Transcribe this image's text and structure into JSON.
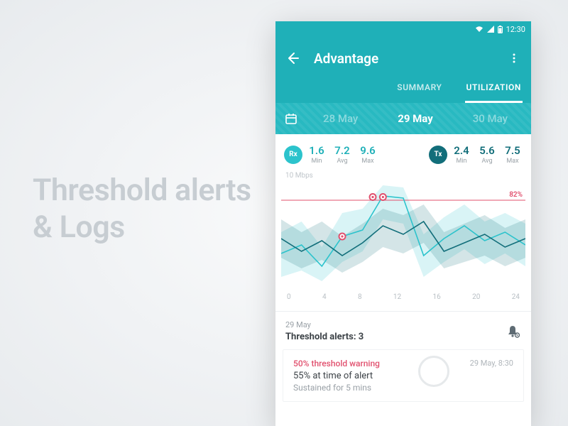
{
  "background_title_line1": "Threshold alerts",
  "background_title_line2": "& Logs",
  "statusbar": {
    "time": "12:30"
  },
  "appbar": {
    "title": "Advantage"
  },
  "tabs": {
    "summary": "SUMMARY",
    "utilization": "UTILIZATION",
    "active": "utilization"
  },
  "dates": {
    "d0": "28 May",
    "d1": "29 May",
    "d2": "30 May",
    "active": "d1"
  },
  "metrics": {
    "rx": {
      "badge": "Rx",
      "min": "1.6",
      "avg": "7.2",
      "max": "9.6"
    },
    "tx": {
      "badge": "Tx",
      "min": "2.4",
      "avg": "5.6",
      "max": "7.5"
    },
    "labels": {
      "min": "Min",
      "avg": "Avg",
      "max": "Max"
    }
  },
  "chart_data": {
    "type": "line",
    "ylabel": "10 Mbps",
    "ylim": [
      0,
      10
    ],
    "threshold_pct": "82%",
    "threshold_value": 8.2,
    "x": [
      0,
      2,
      4,
      6,
      8,
      10,
      12,
      14,
      16,
      18,
      20,
      22,
      24
    ],
    "x_ticks": [
      "0",
      "4",
      "8",
      "12",
      "16",
      "20",
      "24"
    ],
    "series": [
      {
        "name": "Rx",
        "color": "#2cc3cc",
        "values": [
          3.2,
          4.0,
          2.0,
          4.8,
          5.4,
          8.6,
          8.4,
          3.0,
          4.6,
          5.8,
          4.4,
          5.2,
          4.0
        ],
        "band_low": [
          1.0,
          1.6,
          0.6,
          2.4,
          3.4,
          6.4,
          6.0,
          1.0,
          2.4,
          3.6,
          2.2,
          3.2,
          2.0
        ],
        "band_high": [
          5.2,
          6.2,
          3.8,
          7.0,
          7.4,
          9.6,
          9.4,
          5.0,
          6.6,
          7.8,
          6.2,
          7.0,
          6.0
        ]
      },
      {
        "name": "Tx",
        "color": "#126e7a",
        "values": [
          4.6,
          3.4,
          4.4,
          3.0,
          4.2,
          5.8,
          5.0,
          6.2,
          3.4,
          4.2,
          5.0,
          3.8,
          4.6
        ],
        "band_low": [
          2.8,
          1.8,
          2.6,
          1.4,
          2.4,
          3.8,
          3.2,
          4.2,
          1.8,
          2.4,
          3.0,
          2.0,
          2.8
        ],
        "band_high": [
          6.4,
          5.2,
          6.2,
          4.8,
          6.0,
          7.4,
          6.8,
          7.8,
          5.2,
          6.0,
          6.8,
          5.6,
          6.4
        ]
      }
    ],
    "markers": [
      {
        "x": 9,
        "y": 8.5
      },
      {
        "x": 10,
        "y": 8.5
      },
      {
        "x": 6,
        "y": 4.8
      }
    ]
  },
  "alerts": {
    "date": "29 May",
    "title_prefix": "Threshold alerts: ",
    "count": "3",
    "items": [
      {
        "warning": "50% threshold warning",
        "value_line": "55% at time of alert",
        "sustain": "Sustained for 5 mins",
        "time": "29 May, 8:30"
      }
    ]
  },
  "colors": {
    "teal": "#1fb0b8",
    "teal_dark": "#126e7a",
    "red": "#e1506e"
  }
}
